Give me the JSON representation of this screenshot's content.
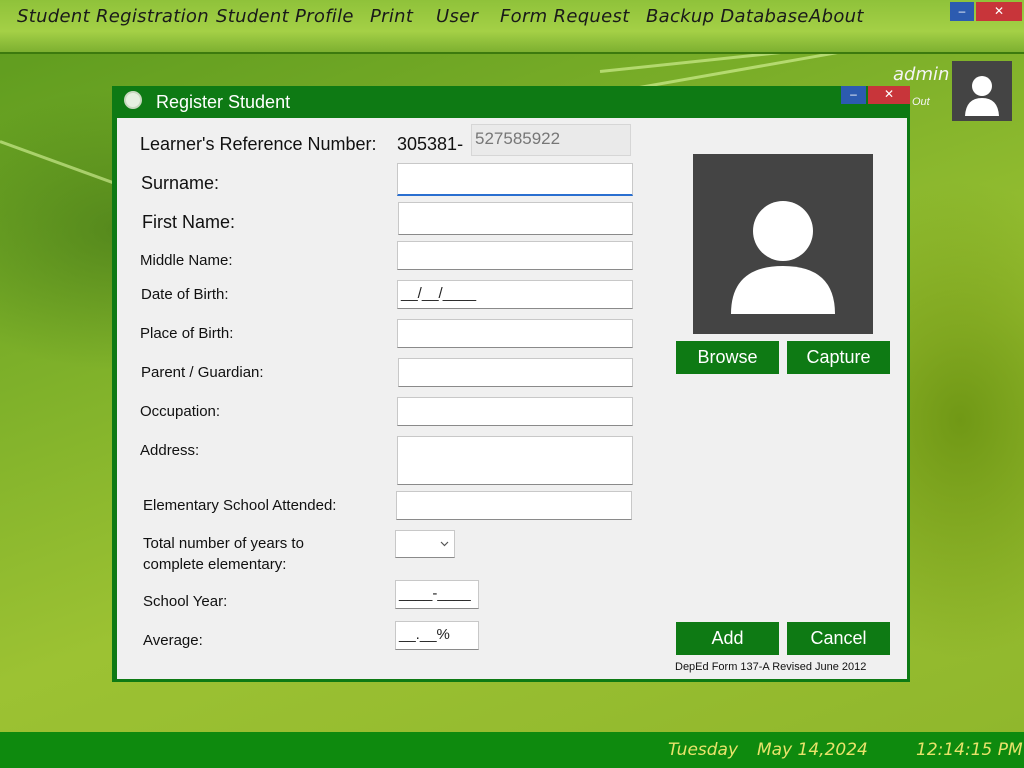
{
  "menu": {
    "items": [
      "Student Registration",
      "Student Profile",
      "Print",
      "User",
      "Form Request",
      "Backup Database",
      "About"
    ],
    "minimize_icon": "minimize-icon",
    "close_icon": "close-icon",
    "minimize_glyph": "–",
    "close_glyph": "✕"
  },
  "user": {
    "name": "admin",
    "logout": "Out",
    "avatar_icon": "user-icon"
  },
  "dialog": {
    "title": "Register Student",
    "minimize_glyph": "–",
    "close_glyph": "✕",
    "fields": {
      "lrn_label": "Learner's Reference Number:",
      "lrn_prefix": "305381-",
      "lrn_value": "527585922",
      "surname_label": "Surname:",
      "surname_value": "",
      "firstname_label": "First Name:",
      "firstname_value": "",
      "middlename_label": "Middle Name:",
      "middlename_value": "",
      "dob_label": "Date of Birth:",
      "dob_value": "__/__/____",
      "pob_label": "Place of Birth:",
      "pob_value": "",
      "guardian_label": "Parent / Guardian:",
      "guardian_value": "",
      "occupation_label": "Occupation:",
      "occupation_value": "",
      "address_label": "Address:",
      "address_value": "",
      "elementary_label": "Elementary School Attended:",
      "elementary_value": "",
      "years_label_1": "Total number of years to",
      "years_label_2": "complete elementary:",
      "years_value": "",
      "schoolyear_label": "School Year:",
      "schoolyear_value": "____-____",
      "average_label": "Average:",
      "average_value": "__.__%"
    },
    "buttons": {
      "browse": "Browse",
      "capture": "Capture",
      "add": "Add",
      "cancel": "Cancel"
    },
    "form_note": "DepEd Form 137-A Revised June 2012"
  },
  "status": {
    "day": "Tuesday",
    "date": "May 14,2024",
    "time": "12:14:15 PM"
  },
  "colors": {
    "accent_green": "#0e7a14",
    "statusbar_green": "#0e8a0e",
    "status_text": "#e8e36a",
    "close_red": "#c8353a",
    "minimize_blue": "#2c5bb0"
  }
}
